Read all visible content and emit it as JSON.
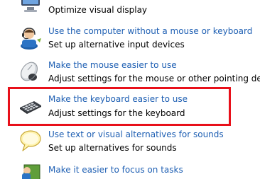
{
  "items": [
    {
      "id": "display",
      "link": "",
      "description": "Optimize visual display",
      "icon": "monitor-icon"
    },
    {
      "id": "no-mouse-keyboard",
      "link": "Use the computer without a mouse or keyboard",
      "description": "Set up alternative input devices",
      "icon": "person-headset-icon"
    },
    {
      "id": "mouse",
      "link": "Make the mouse easier to use",
      "description": "Adjust settings for the mouse or other pointing devices",
      "icon": "mouse-icon"
    },
    {
      "id": "keyboard",
      "link": "Make the keyboard easier to use",
      "description": "Adjust settings for the keyboard",
      "icon": "keyboard-icon"
    },
    {
      "id": "sounds",
      "link": "Use text or visual alternatives for sounds",
      "description": "Set up alternatives for sounds",
      "icon": "speech-bubble-icon"
    },
    {
      "id": "focus",
      "link": "Make it easier to focus on tasks",
      "description": "",
      "icon": "focus-tasks-icon"
    }
  ],
  "highlight_color": "#e8101a",
  "link_color": "#1e5fb3"
}
